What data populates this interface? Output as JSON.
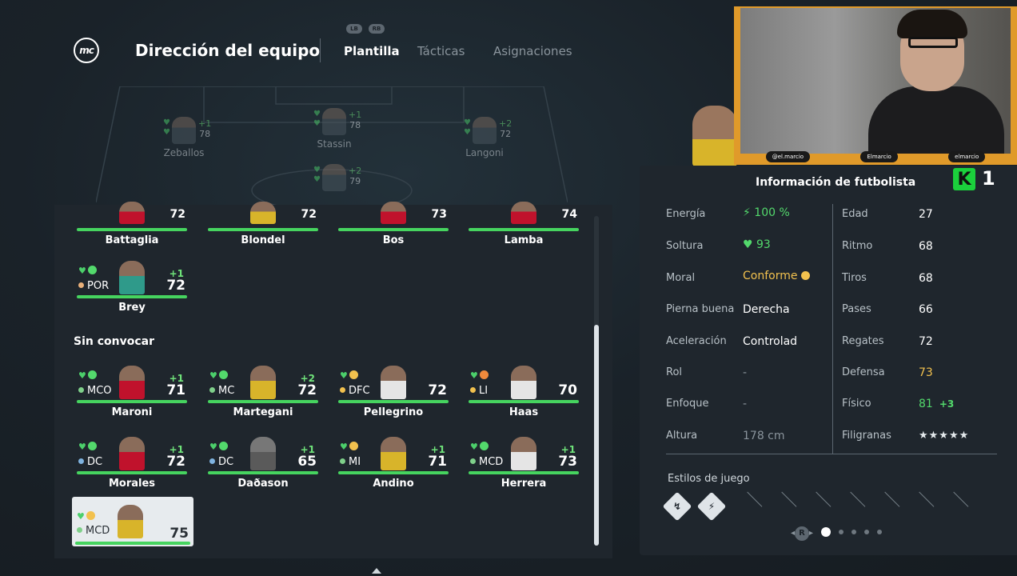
{
  "header": {
    "title": "Dirección del equipo",
    "bumper_left": "LB",
    "bumper_right": "RB",
    "tabs": [
      {
        "label": "Plantilla",
        "active": true
      },
      {
        "label": "Tácticas",
        "active": false
      },
      {
        "label": "Asignaciones",
        "active": false
      }
    ]
  },
  "pitch_players": [
    {
      "name": "Zeballos",
      "plus": "+1",
      "rating": "78"
    },
    {
      "name": "Stassin",
      "plus": "+1",
      "rating": "78"
    },
    {
      "name": "Langoni",
      "plus": "+2",
      "rating": "72"
    },
    {
      "name": "",
      "plus": "+2",
      "rating": "79"
    }
  ],
  "squad": {
    "partial_row": [
      {
        "name": "Battaglia",
        "rating": "72"
      },
      {
        "name": "Blondel",
        "rating": "72"
      },
      {
        "name": "Bos",
        "rating": "73"
      },
      {
        "name": "Lamba",
        "rating": "74"
      }
    ],
    "bench_extra": {
      "name": "Brey",
      "position": "POR",
      "plus": "+1",
      "rating": "72"
    },
    "section_title": "Sin convocar",
    "uncalled": [
      {
        "name": "Maroni",
        "position": "MCO",
        "plus": "+1",
        "rating": "71"
      },
      {
        "name": "Martegani",
        "position": "MC",
        "plus": "+2",
        "rating": "72"
      },
      {
        "name": "Pellegrino",
        "position": "DFC",
        "plus": "",
        "rating": "72"
      },
      {
        "name": "Haas",
        "position": "LI",
        "plus": "",
        "rating": "70"
      },
      {
        "name": "Morales",
        "position": "DC",
        "plus": "+1",
        "rating": "72"
      },
      {
        "name": "Daðason",
        "position": "DC",
        "plus": "+1",
        "rating": "65"
      },
      {
        "name": "Andino",
        "position": "MI",
        "plus": "+1",
        "rating": "71"
      },
      {
        "name": "Herrera",
        "position": "MCD",
        "plus": "+1",
        "rating": "73"
      },
      {
        "name": "",
        "position": "MCD",
        "plus": "",
        "rating": "75"
      }
    ]
  },
  "info": {
    "title": "Información de futbolista",
    "badge_letter": "K",
    "badge_number": "1",
    "left": [
      {
        "label": "Energía",
        "value": "100 %"
      },
      {
        "label": "Soltura",
        "value": "93"
      },
      {
        "label": "Moral",
        "value": "Conforme"
      },
      {
        "label": "Pierna buena",
        "value": "Derecha"
      },
      {
        "label": "Aceleración",
        "value": "Controlad"
      },
      {
        "label": "Rol",
        "value": "-"
      },
      {
        "label": "Enfoque",
        "value": "-"
      },
      {
        "label": "Altura",
        "value": "178 cm"
      }
    ],
    "right": [
      {
        "label": "Edad",
        "value": "27"
      },
      {
        "label": "Ritmo",
        "value": "68"
      },
      {
        "label": "Tiros",
        "value": "68"
      },
      {
        "label": "Pases",
        "value": "66"
      },
      {
        "label": "Regates",
        "value": "72"
      },
      {
        "label": "Defensa",
        "value": "73"
      },
      {
        "label": "Físico",
        "value": "81",
        "plus": "+3"
      },
      {
        "label": "Filigranas",
        "value": "★★★★★"
      }
    ],
    "styles_title": "Estilos de juego",
    "pager_button": "R"
  },
  "webcam": {
    "tags": [
      "@el.marcio",
      "Elmarcio",
      "elmarcio"
    ]
  },
  "colors": {
    "accent_green": "#46d45f",
    "gold": "#f2c14e",
    "panel": "#1f262d"
  }
}
